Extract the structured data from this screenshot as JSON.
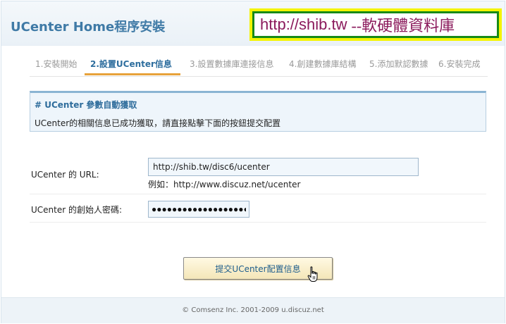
{
  "header": {
    "title": "UCenter Home程序安裝",
    "watermark_url": "http://shib.tw",
    "watermark_suffix": "--軟硬體資料庫"
  },
  "steps": [
    {
      "label": "1.安裝開始",
      "active": false
    },
    {
      "label": "2.設置UCenter信息",
      "active": true
    },
    {
      "label": "3.設置數據庫連接信息",
      "active": false
    },
    {
      "label": "4.創建數據庫結構",
      "active": false
    },
    {
      "label": "5.添加默認數據",
      "active": false
    },
    {
      "label": "6.安裝完成",
      "active": false
    }
  ],
  "notice": {
    "title": "# UCenter 參數自動獲取",
    "text": "UCenter的相關信息已成功獲取，請直接點擊下面的按鈕提交配置"
  },
  "form": {
    "url_label": "UCenter 的 URL:",
    "url_value": "http://shib.tw/disc6/ucenter",
    "url_hint": "例如：http://www.discuz.net/ucenter",
    "password_label": "UCenter 的創始人密碼:",
    "password_mask": "●●●●●●●●●●●●●●●●●●●●"
  },
  "submit_label": "提交UCenter配置信息",
  "footer": {
    "text": "© Comsenz Inc. 2001-2009 u.discuz.net"
  },
  "colors": {
    "accent": "#3f7aa6",
    "step_active": "#2e6e9e",
    "step_underline": "#e7a23a",
    "watermark_text": "#8b1a5c",
    "watermark_border_outer": "#f4f400",
    "watermark_border_inner": "#178a17"
  }
}
